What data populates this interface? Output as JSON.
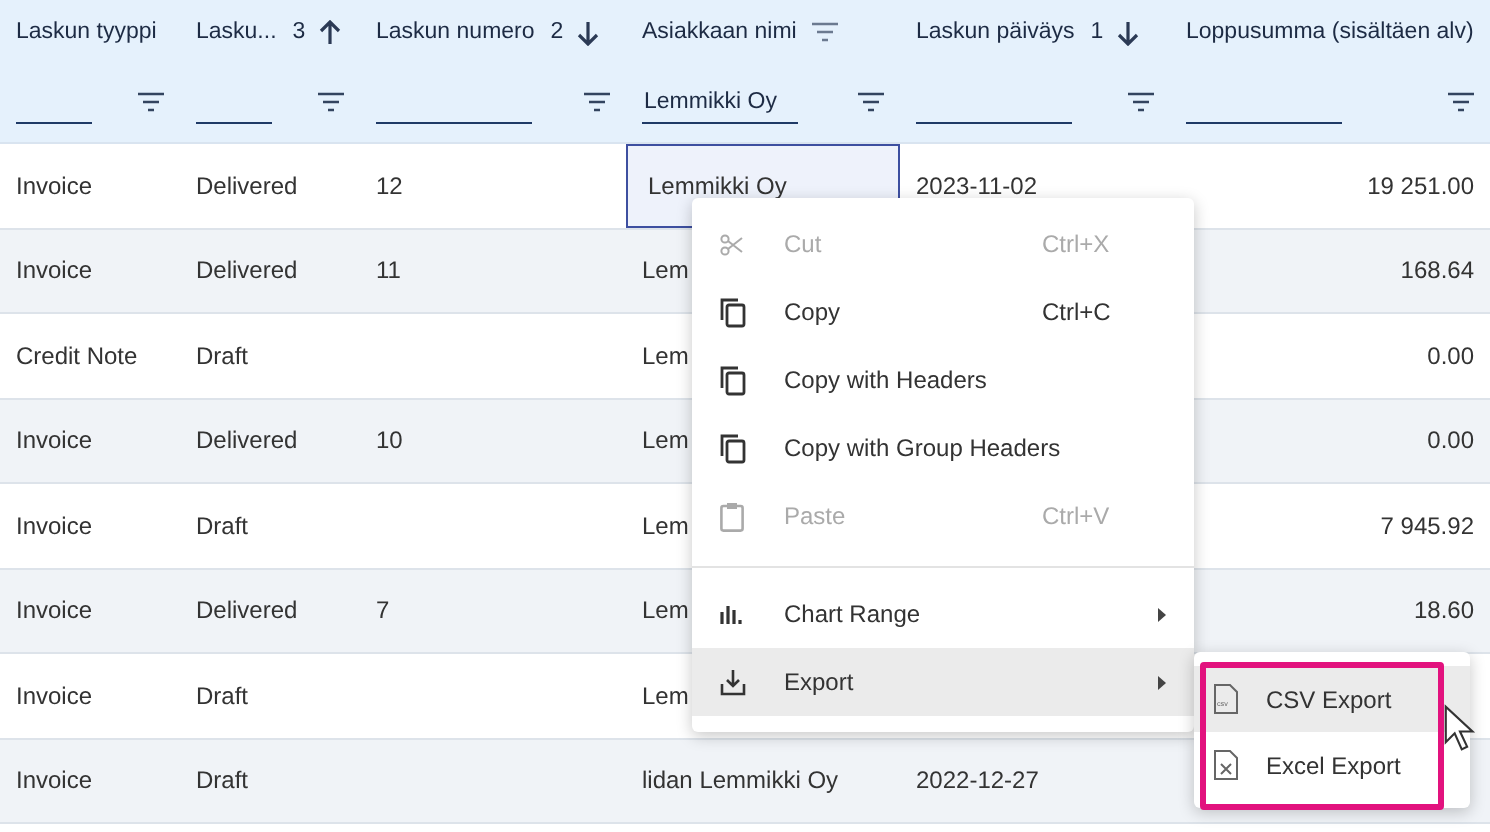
{
  "grid": {
    "columns": [
      {
        "label": "Laskun tyyppi",
        "header_filter": false
      },
      {
        "label": "Lasku...",
        "sort_rank": "3",
        "ascending": true,
        "header_filter": false
      },
      {
        "label": "Laskun numero",
        "sort_rank": "2",
        "ascending": false,
        "header_filter": false
      },
      {
        "label": "Asiakkaan nimi",
        "header_filter": true,
        "filter_value": "Lemmikki Oy"
      },
      {
        "label": "Laskun päiväys",
        "sort_rank": "1",
        "ascending": false,
        "header_filter": false
      },
      {
        "label": "Loppusumma (sisältäen alv)",
        "header_filter": false
      }
    ],
    "rows": [
      {
        "cells": [
          {
            "text": "Invoice",
            "focused": false
          },
          {
            "text": "Delivered",
            "focused": false
          },
          {
            "text": "12",
            "focused": false
          },
          {
            "text": "Lemmikki Oy",
            "focused": true
          },
          {
            "text": "2023-11-02",
            "focused": false
          },
          {
            "text": "19 251.00",
            "focused": false
          }
        ]
      },
      {
        "cells": [
          {
            "text": "Invoice",
            "focused": false
          },
          {
            "text": "Delivered",
            "focused": false
          },
          {
            "text": "11",
            "focused": false
          },
          {
            "text": "Lem",
            "focused": false
          },
          {
            "focused": false
          },
          {
            "text": "168.64",
            "focused": false
          }
        ]
      },
      {
        "cells": [
          {
            "text": "Credit Note",
            "focused": false
          },
          {
            "text": "Draft",
            "focused": false
          },
          {
            "focused": false
          },
          {
            "text": "Lem",
            "focused": false
          },
          {
            "focused": false
          },
          {
            "text": "0.00",
            "focused": false
          }
        ]
      },
      {
        "cells": [
          {
            "text": "Invoice",
            "focused": false
          },
          {
            "text": "Delivered",
            "focused": false
          },
          {
            "text": "10",
            "focused": false
          },
          {
            "text": "Lem",
            "focused": false
          },
          {
            "focused": false
          },
          {
            "text": "0.00",
            "focused": false
          }
        ]
      },
      {
        "cells": [
          {
            "text": "Invoice",
            "focused": false
          },
          {
            "text": "Draft",
            "focused": false
          },
          {
            "focused": false
          },
          {
            "text": "Lem",
            "focused": false
          },
          {
            "focused": false
          },
          {
            "text": "7 945.92",
            "focused": false
          }
        ]
      },
      {
        "cells": [
          {
            "text": "Invoice",
            "focused": false
          },
          {
            "text": "Delivered",
            "focused": false
          },
          {
            "text": "7",
            "focused": false
          },
          {
            "text": "Lem",
            "focused": false
          },
          {
            "focused": false
          },
          {
            "text": "18.60",
            "focused": false
          }
        ]
      },
      {
        "cells": [
          {
            "text": "Invoice",
            "focused": false
          },
          {
            "text": "Draft",
            "focused": false
          },
          {
            "focused": false
          },
          {
            "text": "Lem",
            "focused": false
          },
          {
            "focused": false
          },
          {
            "focused": false
          }
        ]
      },
      {
        "cells": [
          {
            "text": "Invoice",
            "focused": false
          },
          {
            "text": "Draft",
            "focused": false
          },
          {
            "focused": false
          },
          {
            "text": "lidan Lemmikki Oy",
            "focused": false
          },
          {
            "text": "2022-12-27",
            "focused": false
          },
          {
            "focused": false
          }
        ]
      }
    ]
  },
  "context_menu": {
    "items": [
      {
        "kind": "cut",
        "label": "Cut",
        "shortcut": "Ctrl+X",
        "disabled": true,
        "submenu": false,
        "active": false
      },
      {
        "kind": "copy",
        "label": "Copy",
        "shortcut": "Ctrl+C",
        "disabled": false,
        "submenu": false,
        "active": false
      },
      {
        "kind": "copy",
        "label": "Copy with Headers",
        "disabled": false,
        "submenu": false,
        "active": false
      },
      {
        "kind": "copy",
        "label": "Copy with Group Headers",
        "disabled": false,
        "submenu": false,
        "active": false
      },
      {
        "kind": "paste",
        "label": "Paste",
        "shortcut": "Ctrl+V",
        "disabled": true,
        "submenu": false,
        "active": false
      },
      {
        "kind": "separator"
      },
      {
        "kind": "chart",
        "label": "Chart Range",
        "disabled": false,
        "submenu": true,
        "active": false
      },
      {
        "kind": "export",
        "label": "Export",
        "disabled": false,
        "submenu": true,
        "active": true
      }
    ]
  },
  "submenu": {
    "highlight_frame": true,
    "items": [
      {
        "kind": "csv",
        "label": "CSV Export",
        "active": true
      },
      {
        "kind": "excel",
        "label": "Excel Export",
        "active": false
      }
    ]
  }
}
